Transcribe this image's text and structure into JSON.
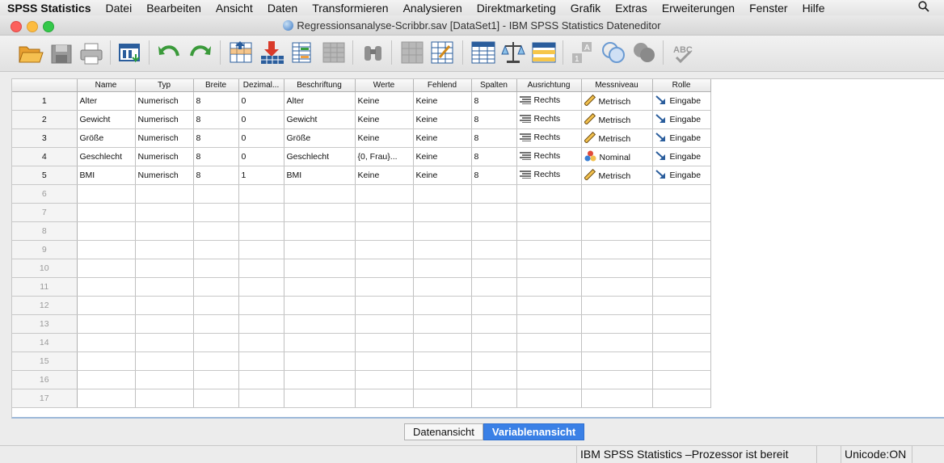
{
  "menubar": {
    "app_name": "SPSS Statistics",
    "items": [
      "Datei",
      "Bearbeiten",
      "Ansicht",
      "Daten",
      "Transformieren",
      "Analysieren",
      "Direktmarketing",
      "Grafik",
      "Extras",
      "Erweiterungen",
      "Fenster",
      "Hilfe"
    ]
  },
  "window": {
    "title": "Regressionsanalyse-Scribbr.sav [DataSet1] - IBM SPSS Statistics Dateneditor"
  },
  "grid": {
    "columns": [
      "Name",
      "Typ",
      "Breite",
      "Dezimal...",
      "Beschriftung",
      "Werte",
      "Fehlend",
      "Spalten",
      "Ausrichtung",
      "Messniveau",
      "Rolle"
    ],
    "rows": [
      {
        "num": "1",
        "name": "Alter",
        "typ": "Numerisch",
        "breite": "8",
        "dezimal": "0",
        "beschriftung": "Alter",
        "werte": "Keine",
        "fehlend": "Keine",
        "spalten": "8",
        "ausrichtung": "Rechts",
        "messniveau": "Metrisch",
        "rolle": "Eingabe"
      },
      {
        "num": "2",
        "name": "Gewicht",
        "typ": "Numerisch",
        "breite": "8",
        "dezimal": "0",
        "beschriftung": "Gewicht",
        "werte": "Keine",
        "fehlend": "Keine",
        "spalten": "8",
        "ausrichtung": "Rechts",
        "messniveau": "Metrisch",
        "rolle": "Eingabe"
      },
      {
        "num": "3",
        "name": "Größe",
        "typ": "Numerisch",
        "breite": "8",
        "dezimal": "0",
        "beschriftung": "Größe",
        "werte": "Keine",
        "fehlend": "Keine",
        "spalten": "8",
        "ausrichtung": "Rechts",
        "messniveau": "Metrisch",
        "rolle": "Eingabe"
      },
      {
        "num": "4",
        "name": "Geschlecht",
        "typ": "Numerisch",
        "breite": "8",
        "dezimal": "0",
        "beschriftung": "Geschlecht",
        "werte": "{0, Frau}...",
        "fehlend": "Keine",
        "spalten": "8",
        "ausrichtung": "Rechts",
        "messniveau": "Nominal",
        "rolle": "Eingabe"
      },
      {
        "num": "5",
        "name": "BMI",
        "typ": "Numerisch",
        "breite": "8",
        "dezimal": "1",
        "beschriftung": "BMI",
        "werte": "Keine",
        "fehlend": "Keine",
        "spalten": "8",
        "ausrichtung": "Rechts",
        "messniveau": "Metrisch",
        "rolle": "Eingabe"
      }
    ],
    "empty_rows": [
      "6",
      "7",
      "8",
      "9",
      "10",
      "11",
      "12",
      "13",
      "14",
      "15",
      "16",
      "17"
    ]
  },
  "tabs": {
    "data_view": "Datenansicht",
    "variable_view": "Variablenansicht",
    "active": "variable_view"
  },
  "status": {
    "processor": "IBM SPSS Statistics –Prozessor ist bereit",
    "encoding": "Unicode:ON"
  },
  "colors": {
    "active_tab": "#3a80e6",
    "close": "#fc605c",
    "minimize": "#fdbc40",
    "zoom": "#34c84a"
  }
}
